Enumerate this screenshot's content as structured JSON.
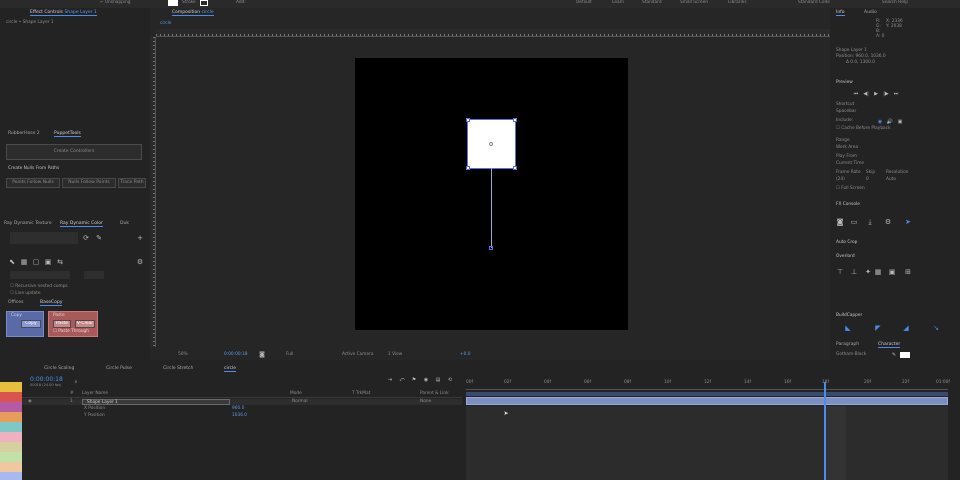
{
  "topbar": {
    "left_menu": "← Unsnapping",
    "tools_label": "Stroke",
    "add_label": "Add:",
    "workspaces": [
      "Default",
      "Learn",
      "Standard",
      "Small Screen",
      "Libraries",
      "Standard Code"
    ],
    "search": "Search Help"
  },
  "effect_controls": {
    "tab": "Effect Controls",
    "layer": "Shape Layer 1",
    "subtitle": "circle • Shape Layer 1"
  },
  "composition": {
    "tab": "Composition",
    "name": "circle",
    "breadcrumb": "circle",
    "zoom": "50%",
    "timecode": "0:00:00:18",
    "resolution": "Full",
    "camera": "Active Camera",
    "view": "1 View",
    "offset": "+0.0"
  },
  "rubber_panel": {
    "tabs": [
      "RubberHose 2",
      "PuppetTools"
    ],
    "create_controllers": "Create Controllers",
    "create_nulls_title": "Create Nulls From Paths",
    "buttons": [
      "Points Follow Nulls",
      "Nulls Follow Points",
      "Trace Path"
    ]
  },
  "dynamic_panel": {
    "tabs": [
      "Ray Dynamic Texture",
      "Ray Dynamic Color",
      "Duk"
    ],
    "checkbox1": "Recursive nested comps",
    "checkbox2": "Live update"
  },
  "basecopy": {
    "tabs": [
      "Offices",
      "BaseCopy"
    ],
    "copy_title": "Copy",
    "copy_btn": "Copy",
    "paste_title": "Paste",
    "paste_btn": "Paste",
    "v_clear_btn": "V-Clear",
    "paste_through": "Paste Through"
  },
  "info": {
    "tabs": [
      "Info",
      "Audio"
    ],
    "r": "R:",
    "g": "G:",
    "b": "B:",
    "a": "A: 0",
    "x": "X: 2336",
    "y": "Y: 2038",
    "layer": "Shape Layer 1",
    "position": "Position: 960.0, 1036.0",
    "delta": "Δ 0.0, 1300.0"
  },
  "preview": {
    "title": "Preview",
    "shortcut_label": "Shortcut",
    "shortcut_value": "Spacebar",
    "include_label": "Include:",
    "cache_label": "Cache Before Playback",
    "range_label": "Range",
    "range_value": "Work Area",
    "play_from_label": "Play From",
    "play_from_value": "Current Time",
    "frame_rate_label": "Frame Rate",
    "skip_label": "Skip",
    "resolution_label": "Resolution",
    "frame_rate_value": "(24)",
    "skip_value": "0",
    "resolution_value": "Auto",
    "full_screen": "Full Screen"
  },
  "fx_console": {
    "title": "FX Console"
  },
  "auto_crop": {
    "title": "Auto Crop"
  },
  "overlord": {
    "title": "Overlord"
  },
  "bulletchapper": {
    "title": "BuildCapper"
  },
  "paragraph": {
    "tabs": [
      "Paragraph",
      "Character"
    ],
    "font": "Gotham-Black"
  },
  "timeline": {
    "tabs": [
      "Circle Scaling",
      "Circle Pulse",
      "Circle Stretch",
      "circle"
    ],
    "active_tab": "circle",
    "timecode": "0:00:00:18",
    "fps": "00018 (24.00 fps)",
    "columns": [
      "#",
      "Layer Name",
      "Mode",
      "T TrkMat",
      "Parent & Link"
    ],
    "layer_num": "1",
    "layer_name": "Shape Layer 1",
    "layer_mode": "Normal",
    "layer_parent": "None",
    "props": [
      {
        "name": "X Position",
        "value": "960.0"
      },
      {
        "name": "Y Position",
        "value": "1036.0"
      }
    ],
    "ruler": [
      "00f",
      "02f",
      "04f",
      "06f",
      "08f",
      "10f",
      "12f",
      "14f",
      "16f",
      "18f",
      "20f",
      "22f",
      "01:00f"
    ]
  },
  "colors": {
    "accent_blue": "#4a8df0",
    "layer_bar": "#7c8fc2",
    "playhead": "#4a8df0",
    "copy_box": "#5a6aa8",
    "paste_box": "#a85a5a"
  },
  "label_swatches": [
    "#e6c03c",
    "#d9534f",
    "#b55ba5",
    "#e89c5a",
    "#7ec8c8",
    "#f0b0c0",
    "#d6d0a0",
    "#c3e0a8",
    "#f0c8a0",
    "#a8b8f0"
  ]
}
